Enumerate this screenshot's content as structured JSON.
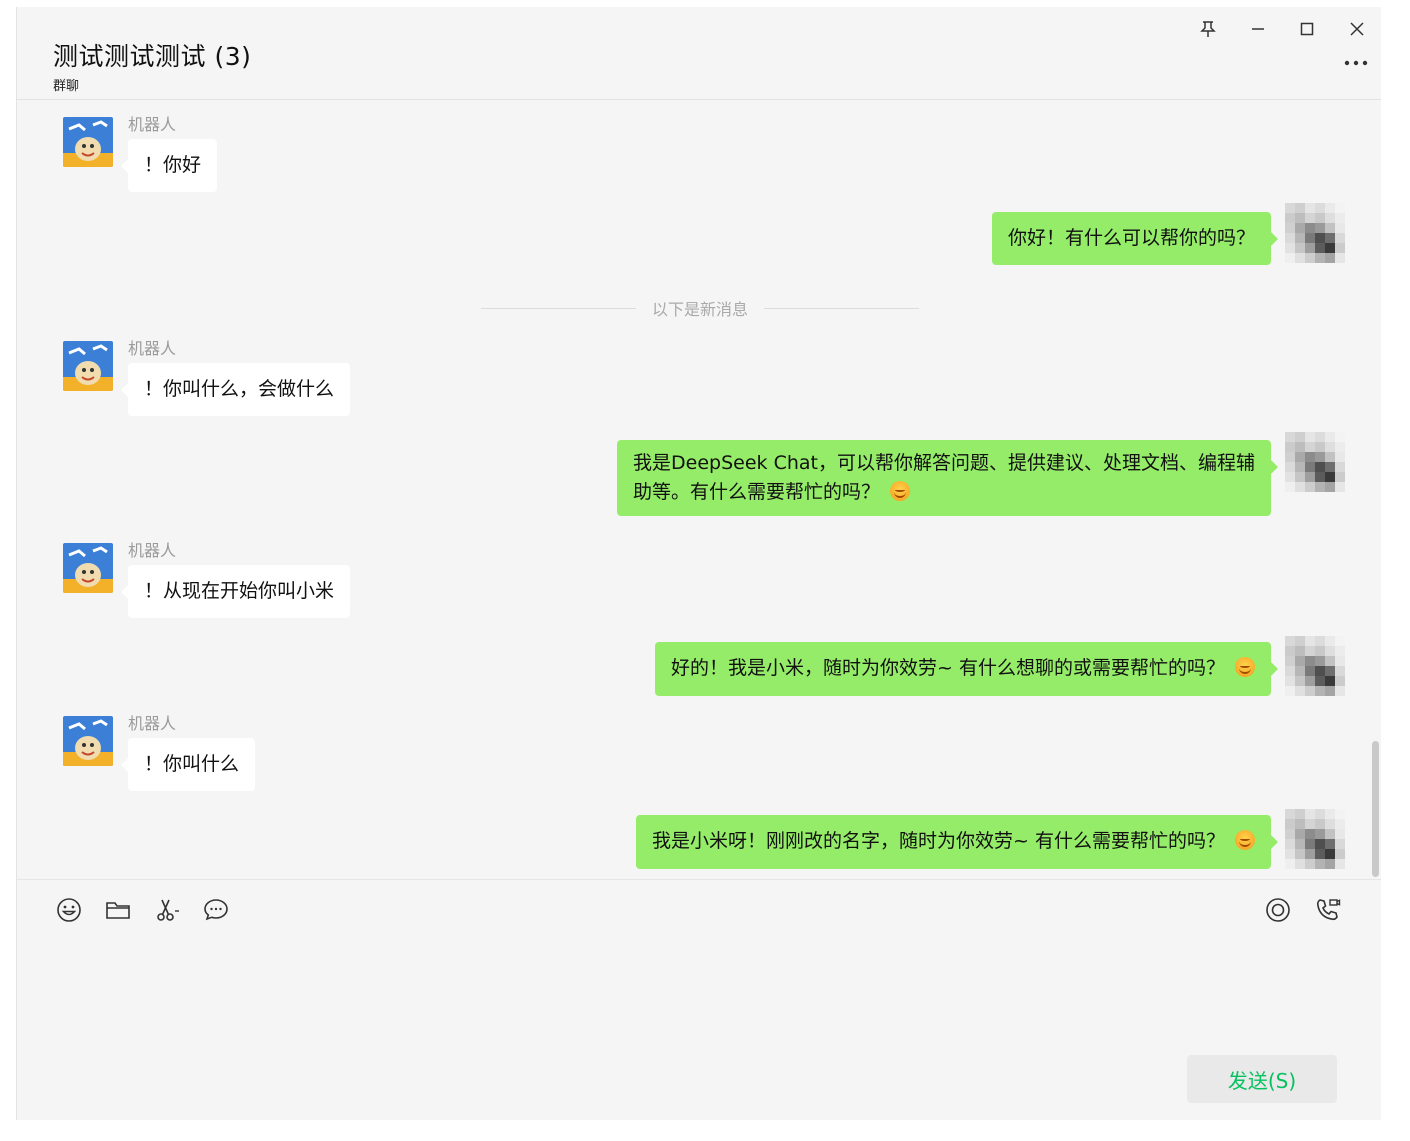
{
  "header": {
    "title": "测试测试测试 (3)",
    "subtitle": "群聊"
  },
  "window_controls": {
    "pin": "pin-icon",
    "minimize": "minimize-icon",
    "maximize": "maximize-icon",
    "close": "close-icon",
    "more": "more-icon"
  },
  "divider_text": "以下是新消息",
  "messages": [
    {
      "direction": "in",
      "sender": "机器人",
      "text": "！你好"
    },
    {
      "direction": "out",
      "text": "你好！有什么可以帮你的吗？"
    },
    {
      "direction": "in",
      "sender": "机器人",
      "text": "！你叫什么，会做什么"
    },
    {
      "direction": "out",
      "text": "我是DeepSeek Chat，可以帮你解答问题、提供建议、处理文档、编程辅\n助等。有什么需要帮忙的吗？",
      "emoji": true
    },
    {
      "direction": "in",
      "sender": "机器人",
      "text": "！从现在开始你叫小米"
    },
    {
      "direction": "out",
      "text": "好的！我是小米，随时为你效劳~ 有什么想聊的或需要帮忙的吗？",
      "emoji": true
    },
    {
      "direction": "in",
      "sender": "机器人",
      "text": "！你叫什么"
    },
    {
      "direction": "out",
      "text": "我是小米呀！刚刚改的名字，随时为你效劳~ 有什么需要帮忙的吗？",
      "emoji": true
    }
  ],
  "toolbar": {
    "left_icons": [
      "emoji-icon",
      "folder-icon",
      "scissors-icon",
      "chat-bubble-icon"
    ],
    "right_icons": [
      "live-icon",
      "call-icon"
    ]
  },
  "send_label": "发送(S)",
  "colors": {
    "bubble_out": "#95ec69",
    "bubble_in": "#ffffff",
    "background": "#f5f5f5",
    "send_text": "#07c160"
  }
}
